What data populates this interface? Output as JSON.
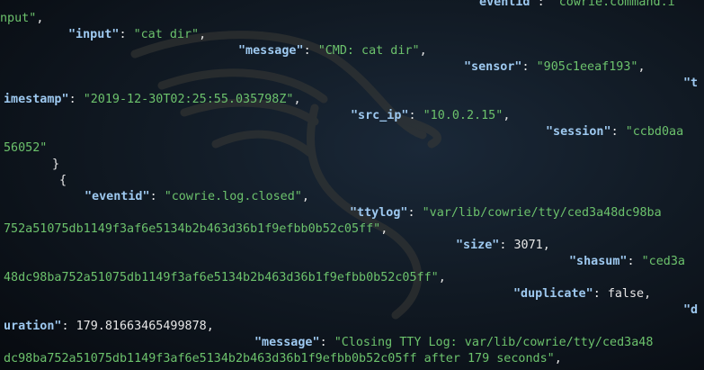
{
  "terminal": {
    "lines": [
      {
        "indent": "",
        "segs": [
          {
            "t": "\"eventid\"",
            "c": "key"
          },
          {
            "t": ": ",
            "c": "plain"
          },
          {
            "t": "\"cowrie.command.i",
            "c": "str"
          }
        ],
        "pad": 525
      },
      {
        "indent": "",
        "segs": [
          {
            "t": "nput\"",
            "c": "str"
          },
          {
            "t": ",",
            "c": "plain"
          }
        ],
        "pad": 0
      },
      {
        "indent": "",
        "segs": [
          {
            "t": "\"input\"",
            "c": "key"
          },
          {
            "t": ": ",
            "c": "plain"
          },
          {
            "t": "\"cat dir\"",
            "c": "str"
          },
          {
            "t": ",",
            "c": "plain"
          }
        ],
        "pad": 76
      },
      {
        "indent": "",
        "segs": [
          {
            "t": "\"message\"",
            "c": "key"
          },
          {
            "t": ": ",
            "c": "plain"
          },
          {
            "t": "\"CMD: cat dir\"",
            "c": "str"
          },
          {
            "t": ",",
            "c": "plain"
          }
        ],
        "pad": 265
      },
      {
        "indent": "",
        "segs": [
          {
            "t": "\"sensor\"",
            "c": "key"
          },
          {
            "t": ": ",
            "c": "plain"
          },
          {
            "t": "\"905c1eeaf193\"",
            "c": "str"
          },
          {
            "t": ",",
            "c": "plain"
          }
        ],
        "pad": 516
      },
      {
        "indent": "",
        "segs": [
          {
            "t": "\"t",
            "c": "key"
          }
        ],
        "pad": 760
      },
      {
        "indent": "",
        "segs": [
          {
            "t": "imestamp\"",
            "c": "key"
          },
          {
            "t": ": ",
            "c": "plain"
          },
          {
            "t": "\"2019-12-30T02:25:55.035798Z\"",
            "c": "str"
          },
          {
            "t": ",",
            "c": "plain"
          }
        ],
        "pad": 4
      },
      {
        "indent": "",
        "segs": [
          {
            "t": "\"src_ip\"",
            "c": "key"
          },
          {
            "t": ": ",
            "c": "plain"
          },
          {
            "t": "\"10.0.2.15\"",
            "c": "str"
          },
          {
            "t": ",",
            "c": "plain"
          }
        ],
        "pad": 390
      },
      {
        "indent": "",
        "segs": [
          {
            "t": "\"session\"",
            "c": "key"
          },
          {
            "t": ": ",
            "c": "plain"
          },
          {
            "t": "\"ccbd0aa",
            "c": "str"
          }
        ],
        "pad": 607
      },
      {
        "indent": "",
        "segs": [
          {
            "t": "56052\"",
            "c": "str"
          }
        ],
        "pad": 4
      },
      {
        "indent": "",
        "segs": [
          {
            "t": "}",
            "c": "plain"
          }
        ],
        "pad": 58
      },
      {
        "indent": "",
        "segs": [
          {
            "t": "{",
            "c": "plain"
          }
        ],
        "pad": 66
      },
      {
        "indent": "",
        "segs": [
          {
            "t": "\"eventid\"",
            "c": "key"
          },
          {
            "t": ": ",
            "c": "plain"
          },
          {
            "t": "\"cowrie.log.closed\"",
            "c": "str"
          },
          {
            "t": ",",
            "c": "plain"
          }
        ],
        "pad": 94
      },
      {
        "indent": "",
        "segs": [
          {
            "t": "\"ttylog\"",
            "c": "key"
          },
          {
            "t": ": ",
            "c": "plain"
          },
          {
            "t": "\"var/lib/cowrie/tty/ced3a48dc98ba",
            "c": "str"
          }
        ],
        "pad": 389
      },
      {
        "indent": "",
        "segs": [
          {
            "t": "752a51075db1149f3af6e5134b2b463d36b1f9efbb0b52c05ff\"",
            "c": "str"
          },
          {
            "t": ",",
            "c": "plain"
          }
        ],
        "pad": 4
      },
      {
        "indent": "",
        "segs": [
          {
            "t": "\"size\"",
            "c": "key"
          },
          {
            "t": ": ",
            "c": "plain"
          },
          {
            "t": "3071",
            "c": "num"
          },
          {
            "t": ",",
            "c": "plain"
          }
        ],
        "pad": 507
      },
      {
        "indent": "",
        "segs": [
          {
            "t": "\"shasum\"",
            "c": "key"
          },
          {
            "t": ": ",
            "c": "plain"
          },
          {
            "t": "\"ced3a",
            "c": "str"
          }
        ],
        "pad": 633
      },
      {
        "indent": "",
        "segs": [
          {
            "t": "48dc98ba752a51075db1149f3af6e5134b2b463d36b1f9efbb0b52c05ff\"",
            "c": "str"
          },
          {
            "t": ",",
            "c": "plain"
          }
        ],
        "pad": 4
      },
      {
        "indent": "",
        "segs": [
          {
            "t": "\"duplicate\"",
            "c": "key"
          },
          {
            "t": ": ",
            "c": "plain"
          },
          {
            "t": "false",
            "c": "num"
          },
          {
            "t": ",",
            "c": "plain"
          }
        ],
        "pad": 571
      },
      {
        "indent": "",
        "segs": [
          {
            "t": "\"d",
            "c": "key"
          }
        ],
        "pad": 760
      },
      {
        "indent": "",
        "segs": [
          {
            "t": "uration\"",
            "c": "key"
          },
          {
            "t": ": ",
            "c": "plain"
          },
          {
            "t": "179.81663465499878",
            "c": "num"
          },
          {
            "t": ",",
            "c": "plain"
          }
        ],
        "pad": 4
      },
      {
        "indent": "",
        "segs": [
          {
            "t": "\"message\"",
            "c": "key"
          },
          {
            "t": ": ",
            "c": "plain"
          },
          {
            "t": "\"Closing TTY Log: var/lib/cowrie/tty/ced3a48",
            "c": "str"
          }
        ],
        "pad": 283
      },
      {
        "indent": "",
        "segs": [
          {
            "t": "dc98ba752a51075db1149f3af6e5134b2b463d36b1f9efbb0b52c05ff after 179 seconds\"",
            "c": "str"
          },
          {
            "t": ",",
            "c": "plain"
          }
        ],
        "pad": 4
      }
    ]
  }
}
